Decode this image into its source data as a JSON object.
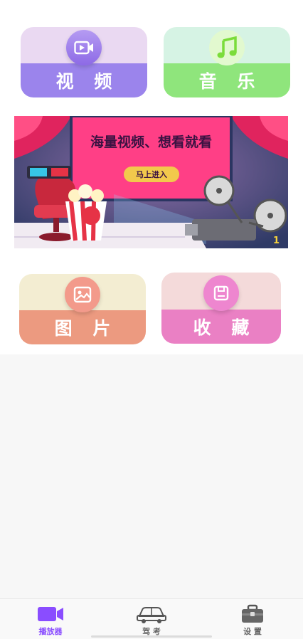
{
  "cards": {
    "video": {
      "label": "视 频",
      "icon": "video-camera-icon"
    },
    "music": {
      "label": "音 乐",
      "icon": "music-note-icon"
    },
    "picture": {
      "label": "图 片",
      "icon": "image-icon"
    },
    "favorite": {
      "label": "收 藏",
      "icon": "floppy-disk-icon"
    }
  },
  "banner": {
    "title": "海量视频、想看就看",
    "button_label": "马上进入",
    "index": "1"
  },
  "tabbar": {
    "items": [
      {
        "label": "播放器",
        "icon": "player-camera-icon",
        "active": true,
        "color": "#8a4dff"
      },
      {
        "label": "驾 考",
        "icon": "car-icon",
        "active": false,
        "color": "#666666"
      },
      {
        "label": "设 置",
        "icon": "toolbox-icon",
        "active": false,
        "color": "#666666"
      }
    ]
  },
  "colors": {
    "video_top": "#ead9f2",
    "video_bottom": "#9b84ec",
    "music_top": "#d6f3e4",
    "music_bottom": "#8fe57c",
    "picture_top": "#f3edd2",
    "picture_bottom": "#ec9a80",
    "favorite_top": "#f4dada",
    "favorite_bottom": "#ea80c4"
  }
}
